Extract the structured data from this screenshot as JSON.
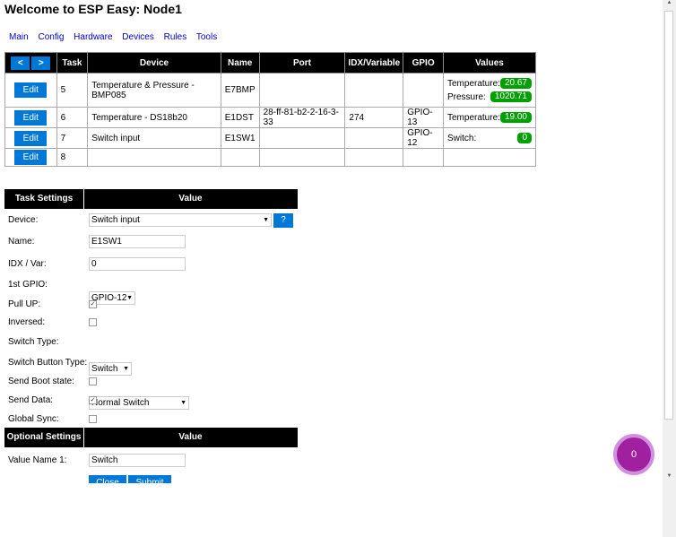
{
  "page": {
    "title": "Welcome to ESP Easy: Node1"
  },
  "nav": [
    "Main",
    "Config",
    "Hardware",
    "Devices",
    "Rules",
    "Tools"
  ],
  "device_table": {
    "prev_label": "<",
    "next_label": ">",
    "headers": [
      "Task",
      "Device",
      "Name",
      "Port",
      "IDX/Variable",
      "GPIO",
      "Values"
    ],
    "edit_label": "Edit",
    "rows": [
      {
        "task": "5",
        "device": "Temperature & Pressure - BMP085",
        "name": "E7BMP",
        "port": "",
        "idx": "",
        "gpio": "",
        "values": [
          {
            "label": "Temperature:",
            "value": "20.67"
          },
          {
            "label": "Pressure:",
            "value": "1020.71"
          }
        ]
      },
      {
        "task": "6",
        "device": "Temperature - DS18b20",
        "name": "E1DST",
        "port": "28-ff-81-b2-2-16-3-33",
        "idx": "274",
        "gpio": "GPIO-13",
        "values": [
          {
            "label": "Temperature:",
            "value": "19.00"
          }
        ]
      },
      {
        "task": "7",
        "device": "Switch input",
        "name": "E1SW1",
        "port": "",
        "idx": "",
        "gpio": "GPIO-12",
        "values": [
          {
            "label": "Switch:",
            "value": "0"
          }
        ]
      },
      {
        "task": "8",
        "device": "",
        "name": "",
        "port": "",
        "idx": "",
        "gpio": "",
        "values": []
      }
    ]
  },
  "task_settings": {
    "header_left": "Task Settings",
    "header_right": "Value",
    "device_label": "Device:",
    "device_value": "Switch input",
    "help_label": "?",
    "name_label": "Name:",
    "name_value": "E1SW1",
    "idx_label": "IDX / Var:",
    "idx_value": "0",
    "gpio_label": "1st GPIO:",
    "gpio_value": "GPIO-12",
    "pullup_label": "Pull UP:",
    "pullup_checked": true,
    "inversed_label": "Inversed:",
    "inversed_checked": false,
    "switch_type_label": "Switch Type:",
    "switch_type_value": "Switch",
    "button_type_label": "Switch Button Type:",
    "button_type_value": "Normal Switch",
    "boot_label": "Send Boot state:",
    "boot_checked": false,
    "send_data_label": "Send Data:",
    "send_data_checked": true,
    "global_sync_label": "Global Sync:",
    "global_sync_checked": false
  },
  "optional_settings": {
    "header_left": "Optional Settings",
    "header_right": "Value",
    "value_name_label": "Value Name 1:",
    "value_name_value": "Switch"
  },
  "buttons": {
    "close": "Close",
    "submit": "Submit"
  },
  "bubble_count": "0",
  "colors": {
    "accent": "#0078d7",
    "value_badge": "#00a000",
    "bubble": "#a020a0",
    "header_bg": "#000000",
    "link": "#0000cc"
  }
}
